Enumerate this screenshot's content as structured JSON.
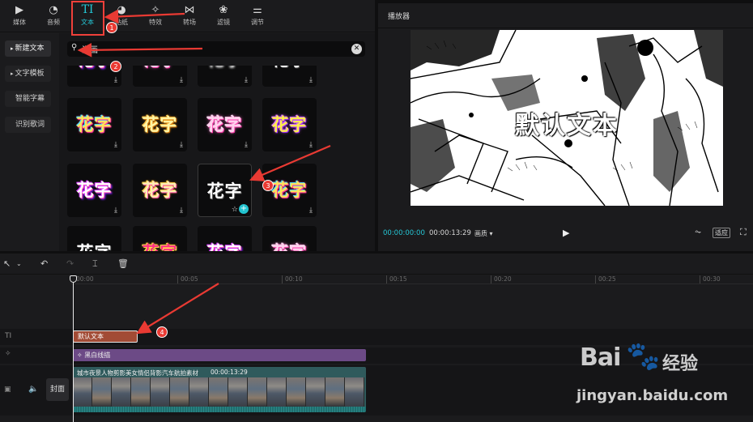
{
  "toolbar": {
    "items": [
      {
        "label": "媒体",
        "icon": "media-icon"
      },
      {
        "label": "音频",
        "icon": "audio-icon"
      },
      {
        "label": "文本",
        "icon": "text-icon",
        "glyph": "TI"
      },
      {
        "label": "贴纸",
        "icon": "sticker-icon"
      },
      {
        "label": "特效",
        "icon": "effects-icon"
      },
      {
        "label": "转场",
        "icon": "transition-icon"
      },
      {
        "label": "滤镜",
        "icon": "filter-icon"
      },
      {
        "label": "调节",
        "icon": "adjust-icon"
      }
    ],
    "active": "文本"
  },
  "sidebar": {
    "items": [
      {
        "label": "新建文本",
        "active": true
      },
      {
        "label": "文字模板",
        "active": false
      },
      {
        "label": "智能字幕",
        "active": false
      },
      {
        "label": "识别歌词",
        "active": false
      }
    ]
  },
  "search": {
    "value": "漫画",
    "placeholder": ""
  },
  "tiles": {
    "text": "花字",
    "row0": [
      "花字",
      "花字",
      "花字",
      "花字"
    ]
  },
  "player": {
    "title": "播放器",
    "overlay_text": "默认文本",
    "current_time": "00:00:00:00",
    "total_time": "00:00:13:29",
    "quality_label": "画质",
    "ratio_label": "适应"
  },
  "timeline": {
    "ticks": [
      "00:00",
      "00:05",
      "00:10",
      "00:15",
      "00:20",
      "00:25",
      "00:30"
    ],
    "text_clip": "默认文本",
    "effect_clip": "黑白线描",
    "video_clip_title": "城市夜景人物剪影美女情侣背影汽车航拍素材",
    "video_clip_duration": "00:00:13:29",
    "cover_label": "封面"
  },
  "annotations": [
    "1",
    "2",
    "3",
    "4"
  ],
  "watermark": {
    "brand": "Bai",
    "brand2": "经验",
    "url": "jingyan.baidu.com"
  },
  "colors": {
    "accent": "#25c7d6",
    "annotation": "#e93a33",
    "text_clip": "#a24b35",
    "effect_clip": "#6c4a86",
    "video_clip": "#2f5a5c"
  }
}
